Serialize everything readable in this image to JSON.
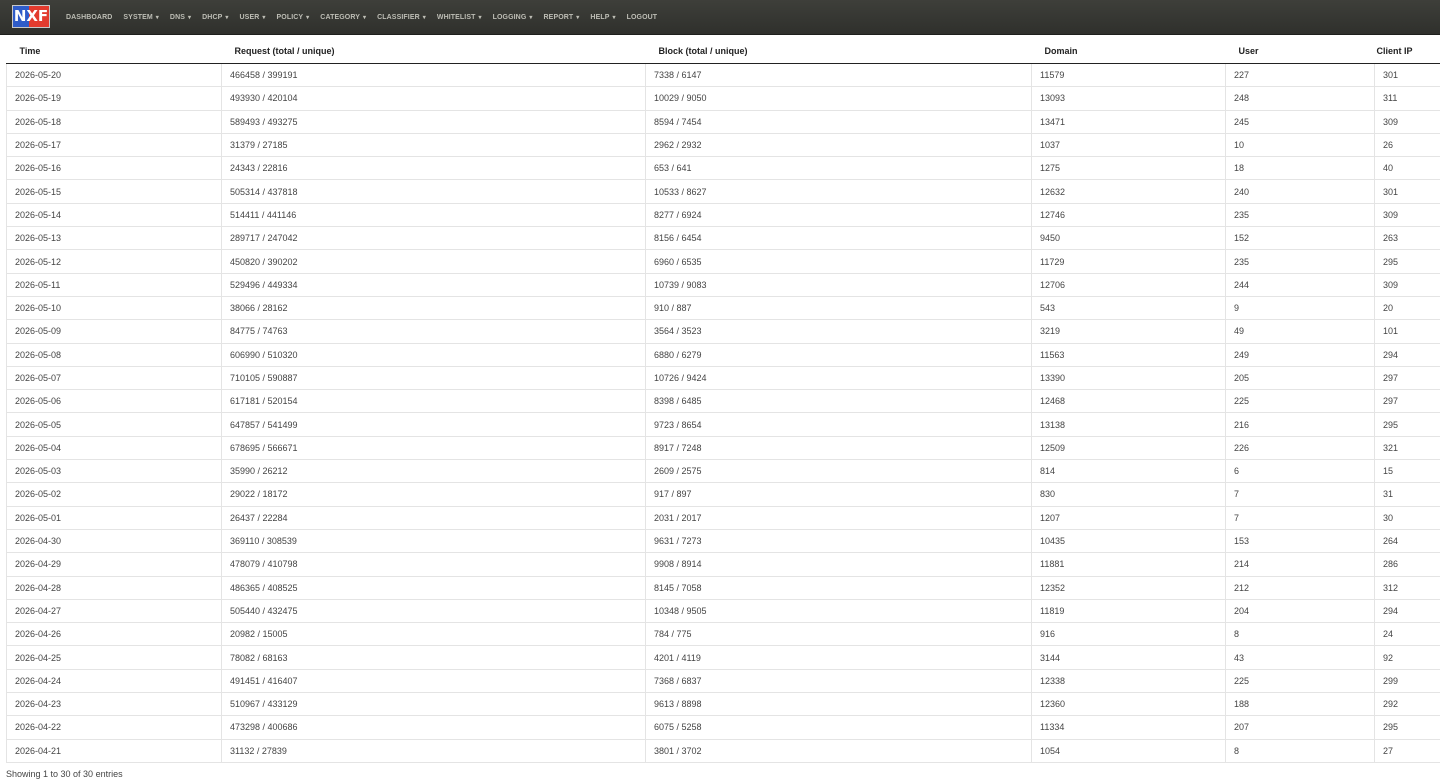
{
  "header": {
    "logo_text": "NXF",
    "nav": [
      {
        "label": "DASHBOARD",
        "has_caret": false
      },
      {
        "label": "SYSTEM",
        "has_caret": true
      },
      {
        "label": "DNS",
        "has_caret": true
      },
      {
        "label": "DHCP",
        "has_caret": true
      },
      {
        "label": "USER",
        "has_caret": true
      },
      {
        "label": "POLICY",
        "has_caret": true
      },
      {
        "label": "CATEGORY",
        "has_caret": true
      },
      {
        "label": "CLASSIFIER",
        "has_caret": true
      },
      {
        "label": "WHITELIST",
        "has_caret": true
      },
      {
        "label": "LOGGING",
        "has_caret": true
      },
      {
        "label": "REPORT",
        "has_caret": true
      },
      {
        "label": "HELP",
        "has_caret": true
      },
      {
        "label": "LOGOUT",
        "has_caret": false
      }
    ]
  },
  "table": {
    "columns": [
      "Time",
      "Request (total / unique)",
      "Block (total / unique)",
      "Domain",
      "User",
      "Client IP"
    ],
    "rows": [
      [
        "2026-05-20",
        "466458 / 399191",
        "7338 / 6147",
        "11579",
        "227",
        "301"
      ],
      [
        "2026-05-19",
        "493930 / 420104",
        "10029 / 9050",
        "13093",
        "248",
        "311"
      ],
      [
        "2026-05-18",
        "589493 / 493275",
        "8594 / 7454",
        "13471",
        "245",
        "309"
      ],
      [
        "2026-05-17",
        "31379 / 27185",
        "2962 / 2932",
        "1037",
        "10",
        "26"
      ],
      [
        "2026-05-16",
        "24343 / 22816",
        "653 / 641",
        "1275",
        "18",
        "40"
      ],
      [
        "2026-05-15",
        "505314 / 437818",
        "10533 / 8627",
        "12632",
        "240",
        "301"
      ],
      [
        "2026-05-14",
        "514411 / 441146",
        "8277 / 6924",
        "12746",
        "235",
        "309"
      ],
      [
        "2026-05-13",
        "289717 / 247042",
        "8156 / 6454",
        "9450",
        "152",
        "263"
      ],
      [
        "2026-05-12",
        "450820 / 390202",
        "6960 / 6535",
        "11729",
        "235",
        "295"
      ],
      [
        "2026-05-11",
        "529496 / 449334",
        "10739 / 9083",
        "12706",
        "244",
        "309"
      ],
      [
        "2026-05-10",
        "38066 / 28162",
        "910 / 887",
        "543",
        "9",
        "20"
      ],
      [
        "2026-05-09",
        "84775 / 74763",
        "3564 / 3523",
        "3219",
        "49",
        "101"
      ],
      [
        "2026-05-08",
        "606990 / 510320",
        "6880 / 6279",
        "11563",
        "249",
        "294"
      ],
      [
        "2026-05-07",
        "710105 / 590887",
        "10726 / 9424",
        "13390",
        "205",
        "297"
      ],
      [
        "2026-05-06",
        "617181 / 520154",
        "8398 / 6485",
        "12468",
        "225",
        "297"
      ],
      [
        "2026-05-05",
        "647857 / 541499",
        "9723 / 8654",
        "13138",
        "216",
        "295"
      ],
      [
        "2026-05-04",
        "678695 / 566671",
        "8917 / 7248",
        "12509",
        "226",
        "321"
      ],
      [
        "2026-05-03",
        "35990 / 26212",
        "2609 / 2575",
        "814",
        "6",
        "15"
      ],
      [
        "2026-05-02",
        "29022 / 18172",
        "917 / 897",
        "830",
        "7",
        "31"
      ],
      [
        "2026-05-01",
        "26437 / 22284",
        "2031 / 2017",
        "1207",
        "7",
        "30"
      ],
      [
        "2026-04-30",
        "369110 / 308539",
        "9631 / 7273",
        "10435",
        "153",
        "264"
      ],
      [
        "2026-04-29",
        "478079 / 410798",
        "9908 / 8914",
        "11881",
        "214",
        "286"
      ],
      [
        "2026-04-28",
        "486365 / 408525",
        "8145 / 7058",
        "12352",
        "212",
        "312"
      ],
      [
        "2026-04-27",
        "505440 / 432475",
        "10348 / 9505",
        "11819",
        "204",
        "294"
      ],
      [
        "2026-04-26",
        "20982 / 15005",
        "784 / 775",
        "916",
        "8",
        "24"
      ],
      [
        "2026-04-25",
        "78082 / 68163",
        "4201 / 4119",
        "3144",
        "43",
        "92"
      ],
      [
        "2026-04-24",
        "491451 / 416407",
        "7368 / 6837",
        "12338",
        "225",
        "299"
      ],
      [
        "2026-04-23",
        "510967 / 433129",
        "9613 / 8898",
        "12360",
        "188",
        "292"
      ],
      [
        "2026-04-22",
        "473298 / 400686",
        "6075 / 5258",
        "11334",
        "207",
        "295"
      ],
      [
        "2026-04-21",
        "31132 / 27839",
        "3801 / 3702",
        "1054",
        "8",
        "27"
      ]
    ]
  },
  "footer": {
    "info": "Showing 1 to 30 of 30 entries"
  }
}
